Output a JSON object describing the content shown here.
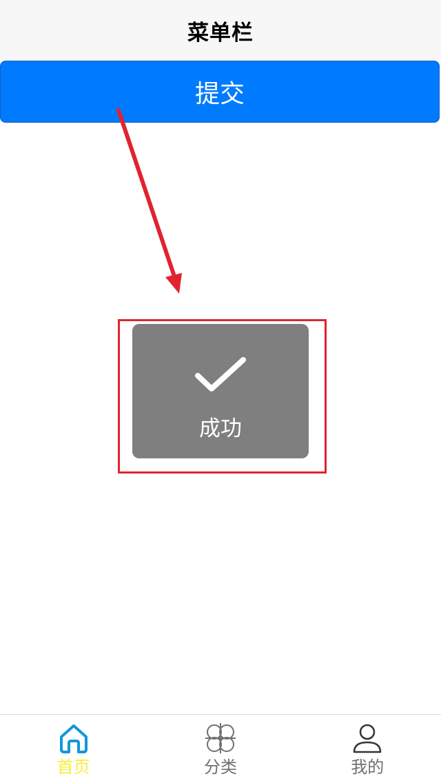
{
  "nav": {
    "title": "菜单栏"
  },
  "submit_button": {
    "label": "提交"
  },
  "toast": {
    "text": "成功",
    "icon": "checkmark-icon"
  },
  "tabbar": {
    "items": [
      {
        "label": "首页",
        "icon": "home-icon",
        "color": "#f6ef37",
        "icon_color": "#1296db",
        "active": true
      },
      {
        "label": "分类",
        "icon": "category-icon",
        "color": "#707070",
        "icon_color": "#707070",
        "active": false
      },
      {
        "label": "我的",
        "icon": "user-icon",
        "color": "#707070",
        "icon_color": "#333333",
        "active": false
      }
    ]
  },
  "colors": {
    "accent": "#007aff",
    "toast_bg": "#7f7f7f",
    "annotation": "#e0242f",
    "nav_bg": "#f7f7f7"
  }
}
